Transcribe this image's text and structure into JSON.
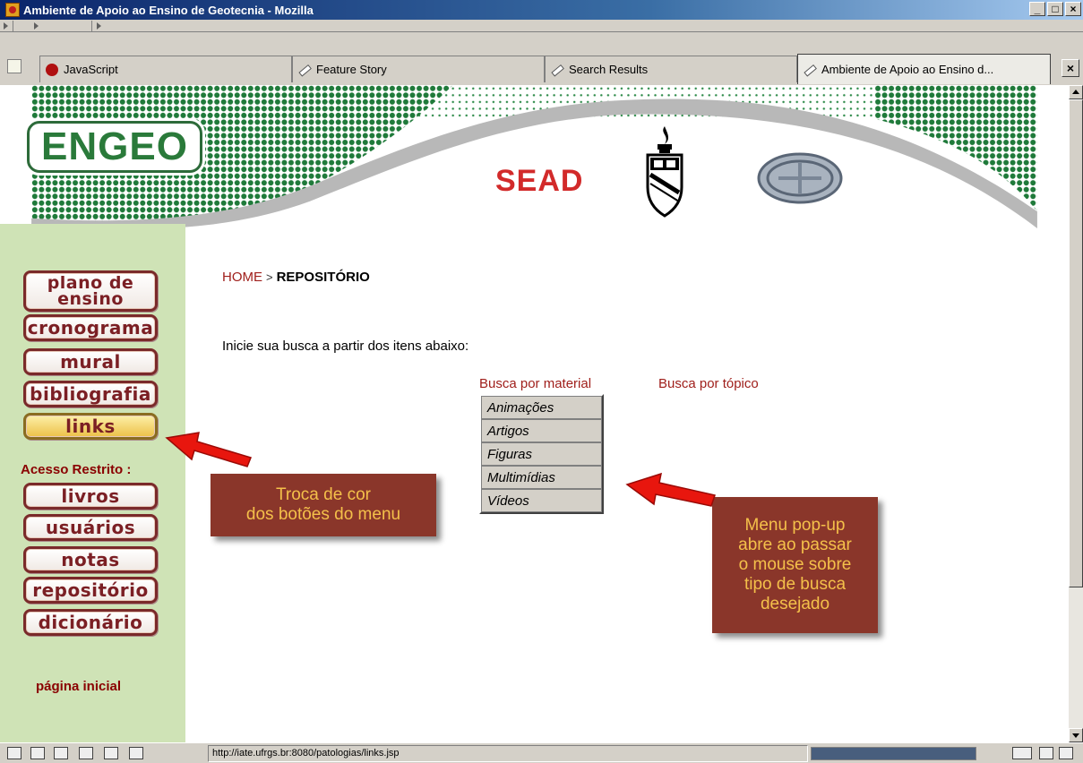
{
  "window": {
    "title": "Ambiente de Apoio ao Ensino de Geotecnia - Mozilla",
    "buttons": {
      "minimize": "_",
      "maximize": "□",
      "close": "×"
    }
  },
  "tabs": [
    {
      "label": "JavaScript",
      "icon": "javascript-icon"
    },
    {
      "label": "Feature Story",
      "icon": "pencil-icon"
    },
    {
      "label": "Search Results",
      "icon": "pencil-icon"
    },
    {
      "label": "Ambiente de Apoio ao Ensino d...",
      "icon": "pencil-icon",
      "active": true
    }
  ],
  "banner": {
    "logo": "ENGEO",
    "sead": "SEAD"
  },
  "sidebar": {
    "menu": [
      {
        "label": "plano de",
        "label2": "ensino"
      },
      {
        "label": "cronograma"
      },
      {
        "label": "mural"
      },
      {
        "label": "bibliografia"
      },
      {
        "label": "links",
        "state": "hover"
      }
    ],
    "restricted_label": "Acesso Restrito :",
    "restricted_menu": [
      {
        "label": "livros"
      },
      {
        "label": "usuários"
      },
      {
        "label": "notas"
      },
      {
        "label": "repositório"
      },
      {
        "label": "dicionário"
      }
    ],
    "home_link": "página inicial"
  },
  "breadcrumb": {
    "home": "HOME",
    "separator": ">",
    "current": "REPOSITÓRIO"
  },
  "intro": "Inicie sua busca a partir dos itens abaixo:",
  "search": {
    "by_material": "Busca por material",
    "by_topic": "Busca por tópico",
    "popup_items": [
      "Animações",
      "Artigos",
      "Figuras",
      "Multimídias",
      "Vídeos"
    ]
  },
  "callouts": {
    "menu_color": [
      "Troca de cor",
      "dos botões do menu"
    ],
    "popup": [
      "Menu pop-up",
      "abre ao passar",
      "o mouse sobre",
      "tipo de busca",
      "desejado"
    ]
  },
  "status": {
    "url": "http://iate.ufrgs.br:8080/patologias/links.jsp"
  },
  "colors": {
    "brand_green": "#2a7a3a",
    "menu_text": "#7b1f24",
    "link_red": "#a0201c",
    "callout_bg": "#8a362a",
    "callout_text": "#f4c04a",
    "sidebar_bg": "#cfe3b6"
  }
}
